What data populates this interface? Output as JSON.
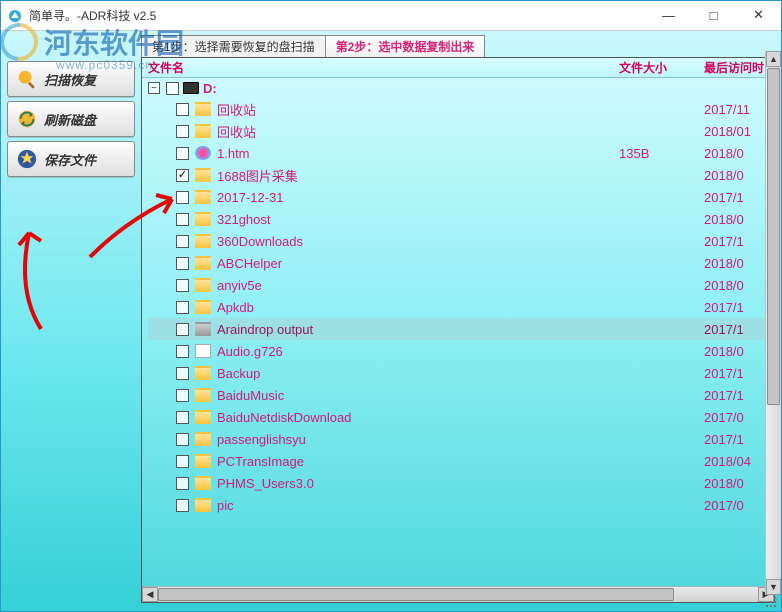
{
  "watermark": {
    "text": "河东软件园",
    "sub": "www.pc0359.cn"
  },
  "window": {
    "title": "简单寻。-ADR科技 v2.5",
    "min": "—",
    "max": "□",
    "close": "✕"
  },
  "sidebar": {
    "btn_scan": "扫描恢复",
    "btn_refresh": "刷新磁盘",
    "btn_save": "保存文件"
  },
  "tabs": {
    "step1": "第1步：选择需要恢复的盘扫描",
    "step2": "第2步：选中数据复制出来"
  },
  "columns": {
    "name": "文件名",
    "size": "文件大小",
    "date": "最后访问时"
  },
  "drive": {
    "toggle": "−",
    "label": "D:"
  },
  "files": [
    {
      "name": "回收站",
      "icon": "folder",
      "size": "",
      "date": "2017/11",
      "checked": false
    },
    {
      "name": "回收站",
      "icon": "folder",
      "size": "",
      "date": "2018/01",
      "checked": false
    },
    {
      "name": "1.htm",
      "icon": "htm",
      "size": "135B",
      "date": "2018/0",
      "checked": false
    },
    {
      "name": "1688图片采集",
      "icon": "folder",
      "size": "",
      "date": "2018/0",
      "checked": true
    },
    {
      "name": "2017-12-31",
      "icon": "folder",
      "size": "",
      "date": "2017/1",
      "checked": false
    },
    {
      "name": "321ghost",
      "icon": "folder",
      "size": "",
      "date": "2018/0",
      "checked": false
    },
    {
      "name": "360Downloads",
      "icon": "folder",
      "size": "",
      "date": "2017/1",
      "checked": false
    },
    {
      "name": "ABCHelper",
      "icon": "folder",
      "size": "",
      "date": "2018/0",
      "checked": false
    },
    {
      "name": "anyiv5e",
      "icon": "folder",
      "size": "",
      "date": "2018/0",
      "checked": false
    },
    {
      "name": "Apkdb",
      "icon": "folder",
      "size": "",
      "date": "2017/1",
      "checked": false
    },
    {
      "name": "Araindrop output",
      "icon": "folder-gray",
      "size": "",
      "date": "2017/1",
      "checked": false,
      "selected": true
    },
    {
      "name": "Audio.g726",
      "icon": "file",
      "size": "",
      "date": "2018/0",
      "checked": false
    },
    {
      "name": "Backup",
      "icon": "folder",
      "size": "",
      "date": "2017/1",
      "checked": false
    },
    {
      "name": "BaiduMusic",
      "icon": "folder",
      "size": "",
      "date": "2017/1",
      "checked": false
    },
    {
      "name": "BaiduNetdiskDownload",
      "icon": "folder",
      "size": "",
      "date": "2017/0",
      "checked": false
    },
    {
      "name": "passenglishsyu",
      "icon": "folder",
      "size": "",
      "date": "2017/1",
      "checked": false
    },
    {
      "name": "PCTransImage",
      "icon": "folder",
      "size": "",
      "date": "2018/04",
      "checked": false
    },
    {
      "name": "PHMS_Users3.0",
      "icon": "folder",
      "size": "",
      "date": "2018/0",
      "checked": false
    },
    {
      "name": "pic",
      "icon": "folder",
      "size": "",
      "date": "2017/0",
      "checked": false
    }
  ]
}
